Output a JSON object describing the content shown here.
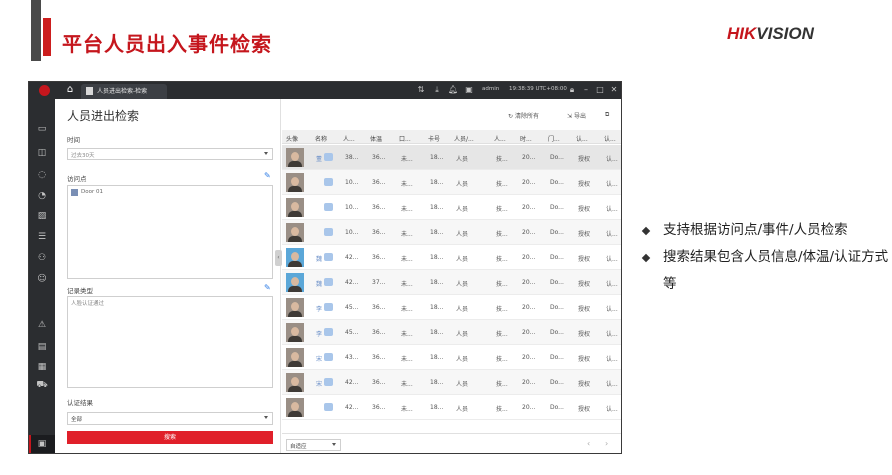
{
  "slide": {
    "title": "平台人员出入事件检索",
    "logo_left": "HIK",
    "logo_right": "VISION"
  },
  "app": {
    "tab_label": "人员进出检索-检索",
    "user": "admin",
    "time": "19:38:39 UTC+08:00",
    "panel_title": "人员进出检索",
    "time_label": "时间",
    "time_value": "过去30天",
    "access_point_label": "访问点",
    "door": "Door 01",
    "record_type_label": "记录类型",
    "record_type_value": "人脸认证通过",
    "auth_result_label": "认证结果",
    "auth_result_value": "全部",
    "search_button": "搜索",
    "reset_filter": "清除所有",
    "export": "导出",
    "columns": [
      "头像",
      "名称",
      "人...",
      "体温",
      "口...",
      "卡号",
      "人员/...",
      "人...",
      "时...",
      "门...",
      "认...",
      "认..."
    ],
    "rows": [
      {
        "name": "董",
        "c2": "38...",
        "c3": "36...",
        "c4": "未...",
        "c5": "18...",
        "c6": "人员",
        "c7": "技...",
        "c8": "20...",
        "c9": "Do...",
        "c10": "授权",
        "c11": "认..."
      },
      {
        "name": "",
        "c2": "10...",
        "c3": "36...",
        "c4": "未...",
        "c5": "18...",
        "c6": "人员",
        "c7": "技...",
        "c8": "20...",
        "c9": "Do...",
        "c10": "授权",
        "c11": "认..."
      },
      {
        "name": "",
        "c2": "10...",
        "c3": "36...",
        "c4": "未...",
        "c5": "18...",
        "c6": "人员",
        "c7": "技...",
        "c8": "20...",
        "c9": "Do...",
        "c10": "授权",
        "c11": "认..."
      },
      {
        "name": "",
        "c2": "10...",
        "c3": "36...",
        "c4": "未...",
        "c5": "18...",
        "c6": "人员",
        "c7": "技...",
        "c8": "20...",
        "c9": "Do...",
        "c10": "授权",
        "c11": "认..."
      },
      {
        "name": "魏",
        "c2": "42...",
        "c3": "36...",
        "c4": "未...",
        "c5": "18...",
        "c6": "人员",
        "c7": "技...",
        "c8": "20...",
        "c9": "Do...",
        "c10": "授权",
        "c11": "认..."
      },
      {
        "name": "魏",
        "c2": "42...",
        "c3": "37...",
        "c4": "未...",
        "c5": "18...",
        "c6": "人员",
        "c7": "技...",
        "c8": "20...",
        "c9": "Do...",
        "c10": "授权",
        "c11": "认..."
      },
      {
        "name": "李",
        "c2": "45...",
        "c3": "36...",
        "c4": "未...",
        "c5": "18...",
        "c6": "人员",
        "c7": "技...",
        "c8": "20...",
        "c9": "Do...",
        "c10": "授权",
        "c11": "认..."
      },
      {
        "name": "李",
        "c2": "45...",
        "c3": "36...",
        "c4": "未...",
        "c5": "18...",
        "c6": "人员",
        "c7": "技...",
        "c8": "20...",
        "c9": "Do...",
        "c10": "授权",
        "c11": "认..."
      },
      {
        "name": "宋",
        "c2": "43...",
        "c3": "36...",
        "c4": "未...",
        "c5": "18...",
        "c6": "人员",
        "c7": "技...",
        "c8": "20...",
        "c9": "Do...",
        "c10": "授权",
        "c11": "认..."
      },
      {
        "name": "宋",
        "c2": "42...",
        "c3": "36...",
        "c4": "未...",
        "c5": "18...",
        "c6": "人员",
        "c7": "技...",
        "c8": "20...",
        "c9": "Do...",
        "c10": "授权",
        "c11": "认..."
      },
      {
        "name": "",
        "c2": "42...",
        "c3": "36...",
        "c4": "未...",
        "c5": "18...",
        "c6": "人员",
        "c7": "技...",
        "c8": "20...",
        "c9": "Do...",
        "c10": "授权",
        "c11": "认..."
      }
    ],
    "sort_value": "自适应"
  },
  "bullets": [
    "支持根据访问点/事件/人员检索",
    "搜索结果包含人员信息/体温/认证方式等"
  ],
  "colors": {
    "brand_red": "#c5161d",
    "search_button": "#e0202a",
    "dark_chrome": "#2b2d30"
  }
}
